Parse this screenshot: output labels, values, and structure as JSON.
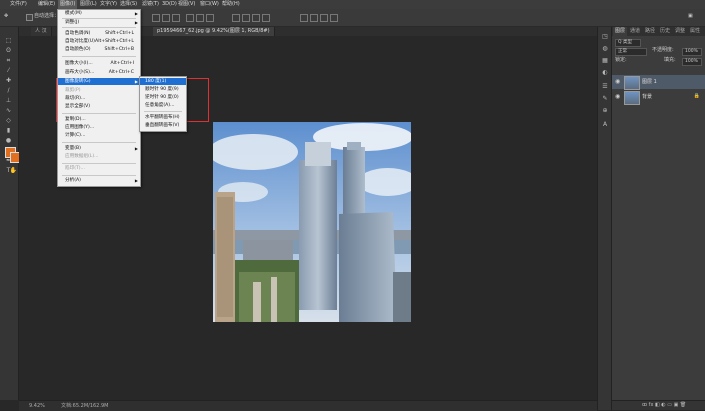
{
  "menubar": {
    "items": [
      "文件(F)",
      "编辑(E)",
      "图像(I)",
      "图层(L)",
      "文字(Y)",
      "选择(S)",
      "滤镜(T)",
      "3D(D)",
      "视图(V)",
      "窗口(W)",
      "帮助(H)"
    ],
    "active_index": 2,
    "min_glyph": "—",
    "max_glyph": "□",
    "close_glyph": "✕"
  },
  "options_bar": {
    "auto_select_label": "自动选择：",
    "layer_dropdown": "图层"
  },
  "document": {
    "tab_left": "人 汉",
    "tab_active": "p19594667_62.jpg @ 9.42%(图层 1, RGB/8#)",
    "zoom": "9.42%",
    "doc_size": "文档:65.2M/162.9M"
  },
  "image_menu": {
    "items": [
      {
        "label": "模式(M)",
        "shortcut": "",
        "arrow": true,
        "disabled": false
      },
      {
        "label": "调整(J)",
        "shortcut": "",
        "arrow": true,
        "disabled": false
      },
      {
        "label": "自动色调(N)",
        "shortcut": "Shift+Ctrl+L",
        "arrow": false,
        "disabled": false
      },
      {
        "label": "自动对比度(U)",
        "shortcut": "Alt+Shift+Ctrl+L",
        "arrow": false,
        "disabled": false
      },
      {
        "label": "自动颜色(O)",
        "shortcut": "Shift+Ctrl+B",
        "arrow": false,
        "disabled": false
      },
      {
        "label": "图像大小(I)...",
        "shortcut": "Alt+Ctrl+I",
        "arrow": false,
        "disabled": false
      },
      {
        "label": "画布大小(S)...",
        "shortcut": "Alt+Ctrl+C",
        "arrow": false,
        "disabled": false
      },
      {
        "label": "图像旋转(G)",
        "shortcut": "",
        "arrow": true,
        "disabled": false,
        "highlight": true
      },
      {
        "label": "裁剪(P)",
        "shortcut": "",
        "arrow": false,
        "disabled": true
      },
      {
        "label": "裁切(R)...",
        "shortcut": "",
        "arrow": false,
        "disabled": false
      },
      {
        "label": "显示全部(V)",
        "shortcut": "",
        "arrow": false,
        "disabled": false
      },
      {
        "label": "复制(D)...",
        "shortcut": "",
        "arrow": false,
        "disabled": false
      },
      {
        "label": "应用图像(Y)...",
        "shortcut": "",
        "arrow": false,
        "disabled": false
      },
      {
        "label": "计算(C)...",
        "shortcut": "",
        "arrow": false,
        "disabled": false
      },
      {
        "label": "变量(B)",
        "shortcut": "",
        "arrow": true,
        "disabled": false
      },
      {
        "label": "应用数据组(L)...",
        "shortcut": "",
        "arrow": false,
        "disabled": true
      },
      {
        "label": "陷印(T)...",
        "shortcut": "",
        "arrow": false,
        "disabled": true
      },
      {
        "label": "分析(A)",
        "shortcut": "",
        "arrow": true,
        "disabled": false
      }
    ]
  },
  "rotate_submenu": {
    "items": [
      {
        "label": "180 度(1)",
        "highlight": true
      },
      {
        "label": "顺时针 90 度(9)"
      },
      {
        "label": "逆时针 90 度(0)"
      },
      {
        "label": "任意角度(A)..."
      },
      {
        "label": "水平翻转画布(H)"
      },
      {
        "label": "垂直翻转画布(V)"
      }
    ]
  },
  "layers_panel": {
    "tabs": [
      "图层",
      "通道",
      "路径",
      "历史",
      "调整",
      "属性"
    ],
    "filter_label": "Q 类型",
    "blend_mode": "正常",
    "opacity_label": "不透明度:",
    "opacity_value": "100%",
    "lock_label": "锁定:",
    "fill_label": "填充:",
    "fill_value": "100%",
    "layers": [
      {
        "name": "图层 1",
        "selected": true,
        "locked": false
      },
      {
        "name": "背景",
        "selected": false,
        "locked": true
      }
    ],
    "footer_icons": "ꝏ fx ◧ ◐ ▭ ▣ 🗑"
  },
  "colors": {
    "foreground": "#e07020",
    "menu_highlight": "#1f6fd2",
    "annotation_box": "#e03030"
  }
}
